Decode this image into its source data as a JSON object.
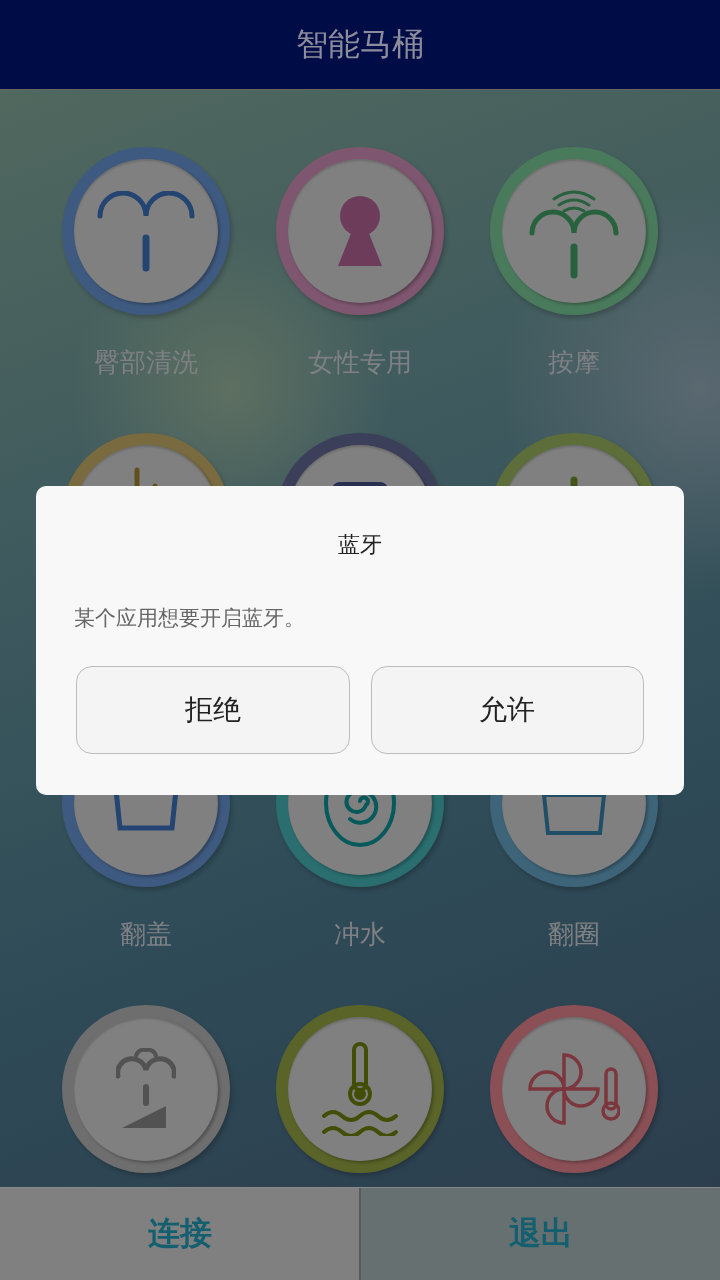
{
  "header": {
    "title": "智能马桶"
  },
  "functions": [
    {
      "label": "臀部清洗",
      "kind": "fountain",
      "color": "#3f5a80"
    },
    {
      "label": "女性专用",
      "kind": "keyhole",
      "color": "#7e566f"
    },
    {
      "label": "按摩",
      "kind": "massage",
      "color": "#4a7a5c"
    },
    {
      "kind": "arc",
      "color": "#7a6a40"
    },
    {
      "kind": "panel",
      "color": "#3c3f5a"
    },
    {
      "kind": "stem",
      "color": "#5e6e3a"
    },
    {
      "label": "翻盖",
      "kind": "lid",
      "color": "#3f5a80"
    },
    {
      "label": "冲水",
      "kind": "spiral",
      "color": "#2a6e70"
    },
    {
      "label": "翻圈",
      "kind": "seat",
      "color": "#3d6478"
    },
    {
      "kind": "strength",
      "color": "#6e6e6e"
    },
    {
      "kind": "water_temp",
      "color": "#5a6428"
    },
    {
      "kind": "fan_temp",
      "color": "#8a5056"
    }
  ],
  "dialog": {
    "title": "蓝牙",
    "message": "某个应用想要开启蓝牙。",
    "buttons": [
      "拒绝",
      "允许"
    ]
  },
  "bottom_bar": [
    "连接",
    "退出"
  ]
}
